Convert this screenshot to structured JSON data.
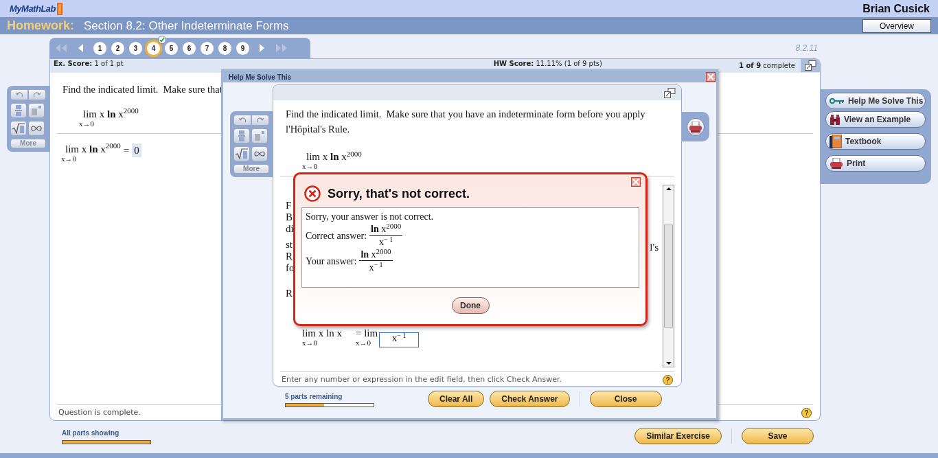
{
  "header": {
    "logo": "MyMathLab",
    "user": "Brian Cusick"
  },
  "title_bar": {
    "label": "Homework:",
    "title": "Section 8.2: Other Indeterminate Forms",
    "button": "Overview"
  },
  "question_nav": [
    {
      "label": "1",
      "selected": false,
      "correct": false
    },
    {
      "label": "2",
      "selected": false,
      "correct": false
    },
    {
      "label": "3",
      "selected": false,
      "correct": false
    },
    {
      "label": "4",
      "selected": true,
      "correct": true
    },
    {
      "label": "5",
      "selected": false,
      "correct": false
    },
    {
      "label": "6",
      "selected": false,
      "correct": false
    },
    {
      "label": "7",
      "selected": false,
      "correct": false
    },
    {
      "label": "8",
      "selected": false,
      "correct": false
    },
    {
      "label": "9",
      "selected": false,
      "correct": false
    }
  ],
  "exercise_id": "8.2.11",
  "palettes": [
    {
      "more": "More",
      "more_disabled": true
    },
    {
      "more": "More",
      "more_disabled": true
    }
  ],
  "help_marks": [
    "?",
    "?"
  ],
  "panel": {
    "ex_score_label": "Ex. Score:",
    "ex_score": "1 of 1 pt",
    "hw_score_label": "HW Score:",
    "hw_score": "11.11% (1 of 9 pts)",
    "complete_count": "1 of 9",
    "complete_word": "complete",
    "question": "Find the indicated limit.  Make sure that",
    "limit": {
      "body": "lim x **ln** x$^{2000}$",
      "under": "x→0"
    },
    "answer": {
      "body": "lim x **ln** x$^{2000}$",
      "under": "x→0",
      "equals": "=",
      "value": "0"
    },
    "status": "Question is complete."
  },
  "sidebar": [
    [
      {
        "kind": "key",
        "label": "Help Me Solve This"
      },
      {
        "kind": "binoculars",
        "label": "View an Example"
      }
    ],
    [
      {
        "kind": "book",
        "label": "Textbook"
      }
    ],
    [
      {
        "kind": "printer",
        "label": "Print"
      }
    ]
  ],
  "footer": {
    "progress_label": "All parts showing",
    "level": 1,
    "buttons": [
      "Similar Exercise",
      "Save"
    ]
  },
  "dialog": {
    "title": "Help Me Solve This",
    "question": "Find the indicated limit.  Make sure that you have an indeterminate form before you apply l'Hôpital's Rule.",
    "limit": {
      "body": "lim x **ln** x$^{2000}$",
      "under": "x→0"
    },
    "fragments_left": [
      "F",
      "B",
      "di",
      "st",
      "R",
      "fo",
      "R"
    ],
    "fragment_right": "l's",
    "work": {
      "left": "lim x ln x",
      "left_under": "x→0",
      "equals": "= lim",
      "right_under": "x→0",
      "box": "x$^{− 1}$"
    },
    "instruction": "Enter any number or expression in the edit field, then click Check Answer.",
    "progress_label": "5 parts remaining",
    "level": 0.44,
    "buttons": [
      "Clear All",
      "Check Answer"
    ],
    "close": "Close"
  },
  "popup": {
    "title": "Sorry, that's not correct.",
    "message": "Sorry, your answer is not correct.",
    "rows": [
      {
        "label": "Correct answer:",
        "num": "**ln** x$^{2000}$",
        "den": "x$^{− 1}$"
      },
      {
        "label": "Your answer:",
        "num": "**ln** x$^{2000}$",
        "den": "x$^{− 1}$"
      }
    ],
    "button": "Done"
  }
}
